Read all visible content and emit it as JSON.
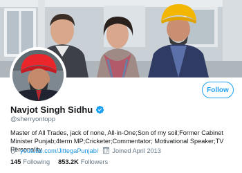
{
  "profile": {
    "display_name": "Navjot Singh Sidhu",
    "handle": "@sherryontopp",
    "bio": "Master of All Trades, jack of none, All-in-One;Son of my soil;Former Cabinet Minister Punjab;4term MP;Cricketer;Commentator; Motivational Speaker;TV Personality",
    "website": "youtube.com/JittegaPunjab/",
    "joined": "Joined April 2013",
    "following_count": "145",
    "following_label": "Following",
    "followers_count": "853.2K",
    "followers_label": "Followers",
    "verified": true
  },
  "actions": {
    "follow_label": "Follow"
  },
  "icons": {
    "verified": "verified-badge-icon",
    "link": "link-icon",
    "calendar": "calendar-icon"
  },
  "colors": {
    "accent": "#1da1f2",
    "link": "#1b95e0",
    "secondary_text": "#657786",
    "primary_text": "#14171a",
    "turban": "#f5b800"
  }
}
